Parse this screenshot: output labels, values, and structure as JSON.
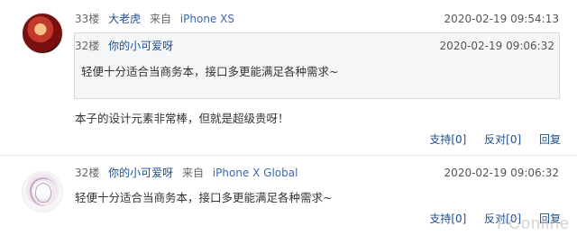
{
  "comments": [
    {
      "floor": "33楼",
      "user": "大老虎",
      "from_label": "来自",
      "device": "iPhone XS",
      "time": "2020-02-19 09:54:13",
      "quote": {
        "floor": "32楼",
        "user": "你的小可爱呀",
        "time": "2020-02-19 09:06:32",
        "text": "轻便十分适合当商务本，接口多更能满足各种需求~"
      },
      "text": "本子的设计元素非常棒，但就是超级贵呀！",
      "actions": {
        "support": "支持[0]",
        "oppose": "反对[0]",
        "reply": "回复"
      }
    },
    {
      "floor": "32楼",
      "user": "你的小可爱呀",
      "from_label": "来自",
      "device": "iPhone X Global",
      "time": "2020-02-19 09:06:32",
      "text": "轻便十分适合当商务本，接口多更能满足各种需求~",
      "actions": {
        "support": "支持[0]",
        "oppose": "反对[0]",
        "reply": "回复"
      }
    }
  ],
  "watermark": "PConline",
  "colors": {
    "link": "#1e4f8f",
    "device": "#3a68b0",
    "quote_bg": "#f5f6f8"
  }
}
